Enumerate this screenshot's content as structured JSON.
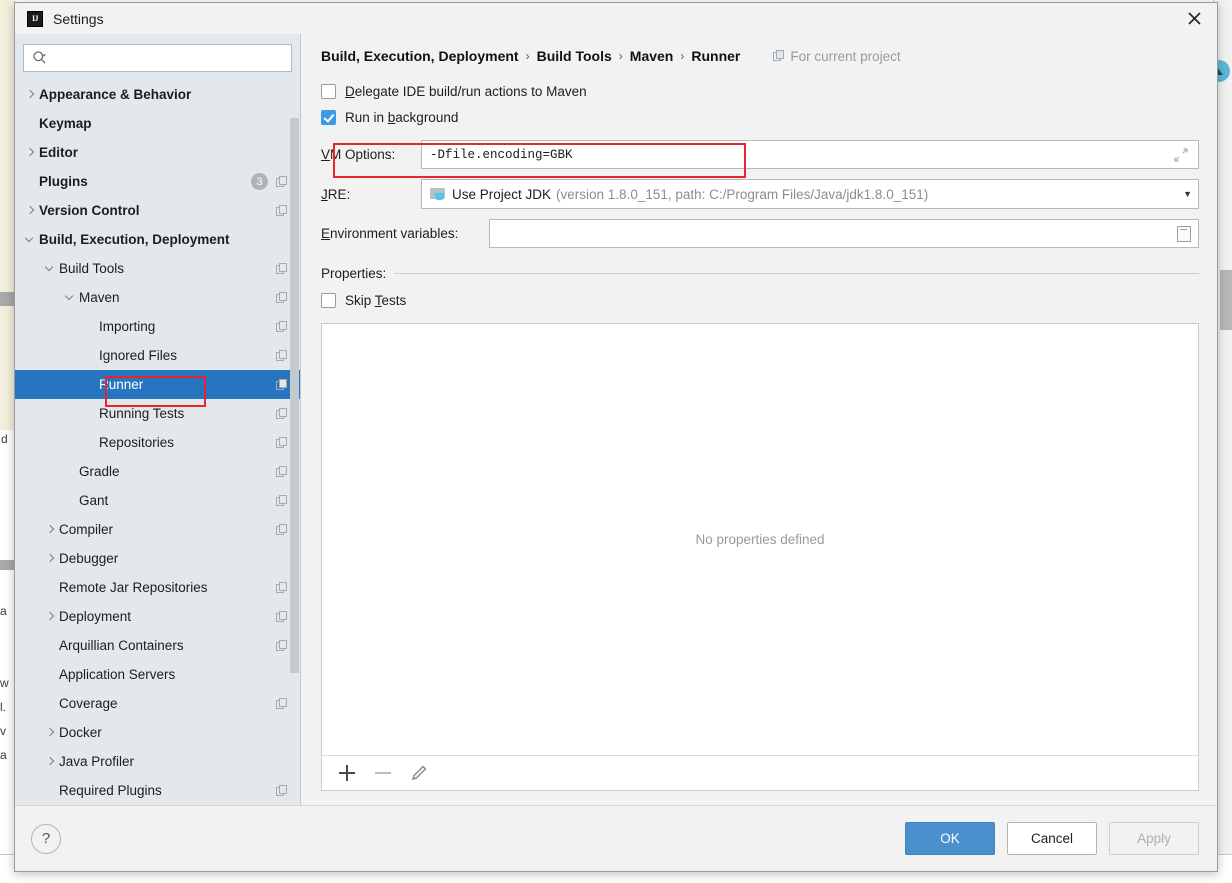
{
  "window": {
    "title": "Settings",
    "app_icon": "intellij-idea-icon",
    "close_icon": "close-icon"
  },
  "sidebar": {
    "search": {
      "placeholder": "",
      "value": "",
      "icon": "search-icon"
    },
    "items": [
      {
        "label": "Appearance & Behavior",
        "indent": 0,
        "arrow": "right",
        "bold": true,
        "project_icon": false,
        "badge": null,
        "selected": false
      },
      {
        "label": "Keymap",
        "indent": 0,
        "arrow": "none",
        "bold": true,
        "project_icon": false,
        "badge": null,
        "selected": false
      },
      {
        "label": "Editor",
        "indent": 0,
        "arrow": "right",
        "bold": true,
        "project_icon": false,
        "badge": null,
        "selected": false
      },
      {
        "label": "Plugins",
        "indent": 0,
        "arrow": "none",
        "bold": true,
        "project_icon": true,
        "badge": "3",
        "selected": false
      },
      {
        "label": "Version Control",
        "indent": 0,
        "arrow": "right",
        "bold": true,
        "project_icon": true,
        "badge": null,
        "selected": false
      },
      {
        "label": "Build, Execution, Deployment",
        "indent": 0,
        "arrow": "down",
        "bold": true,
        "project_icon": false,
        "badge": null,
        "selected": false
      },
      {
        "label": "Build Tools",
        "indent": 1,
        "arrow": "down",
        "bold": false,
        "project_icon": true,
        "badge": null,
        "selected": false
      },
      {
        "label": "Maven",
        "indent": 2,
        "arrow": "down",
        "bold": false,
        "project_icon": true,
        "badge": null,
        "selected": false
      },
      {
        "label": "Importing",
        "indent": 3,
        "arrow": "none",
        "bold": false,
        "project_icon": true,
        "badge": null,
        "selected": false
      },
      {
        "label": "Ignored Files",
        "indent": 3,
        "arrow": "none",
        "bold": false,
        "project_icon": true,
        "badge": null,
        "selected": false
      },
      {
        "label": "Runner",
        "indent": 3,
        "arrow": "none",
        "bold": false,
        "project_icon": true,
        "badge": null,
        "selected": true
      },
      {
        "label": "Running Tests",
        "indent": 3,
        "arrow": "none",
        "bold": false,
        "project_icon": true,
        "badge": null,
        "selected": false
      },
      {
        "label": "Repositories",
        "indent": 3,
        "arrow": "none",
        "bold": false,
        "project_icon": true,
        "badge": null,
        "selected": false
      },
      {
        "label": "Gradle",
        "indent": 2,
        "arrow": "none",
        "bold": false,
        "project_icon": true,
        "badge": null,
        "selected": false
      },
      {
        "label": "Gant",
        "indent": 2,
        "arrow": "none",
        "bold": false,
        "project_icon": true,
        "badge": null,
        "selected": false
      },
      {
        "label": "Compiler",
        "indent": 1,
        "arrow": "right",
        "bold": false,
        "project_icon": true,
        "badge": null,
        "selected": false
      },
      {
        "label": "Debugger",
        "indent": 1,
        "arrow": "right",
        "bold": false,
        "project_icon": false,
        "badge": null,
        "selected": false
      },
      {
        "label": "Remote Jar Repositories",
        "indent": 1,
        "arrow": "none",
        "bold": false,
        "project_icon": true,
        "badge": null,
        "selected": false
      },
      {
        "label": "Deployment",
        "indent": 1,
        "arrow": "right",
        "bold": false,
        "project_icon": true,
        "badge": null,
        "selected": false
      },
      {
        "label": "Arquillian Containers",
        "indent": 1,
        "arrow": "none",
        "bold": false,
        "project_icon": true,
        "badge": null,
        "selected": false
      },
      {
        "label": "Application Servers",
        "indent": 1,
        "arrow": "none",
        "bold": false,
        "project_icon": false,
        "badge": null,
        "selected": false
      },
      {
        "label": "Coverage",
        "indent": 1,
        "arrow": "none",
        "bold": false,
        "project_icon": true,
        "badge": null,
        "selected": false
      },
      {
        "label": "Docker",
        "indent": 1,
        "arrow": "right",
        "bold": false,
        "project_icon": false,
        "badge": null,
        "selected": false
      },
      {
        "label": "Java Profiler",
        "indent": 1,
        "arrow": "right",
        "bold": false,
        "project_icon": false,
        "badge": null,
        "selected": false
      },
      {
        "label": "Required Plugins",
        "indent": 1,
        "arrow": "none",
        "bold": false,
        "project_icon": true,
        "badge": null,
        "selected": false
      }
    ]
  },
  "main": {
    "breadcrumb": {
      "parts": [
        "Build, Execution, Deployment",
        "Build Tools",
        "Maven",
        "Runner"
      ],
      "separator": "›",
      "scope_label": "For current project",
      "scope_icon": "project-scope-icon"
    },
    "delegate": {
      "label_before": "D",
      "label_after": "elegate IDE build/run actions to Maven",
      "checked": false
    },
    "run_in_background": {
      "label_before": "Run in b",
      "label_mid": "b",
      "label_after": "ackground",
      "checked": true
    },
    "vm_options": {
      "label_u": "V",
      "label_rest": "M Options:",
      "value": "-Dfile.encoding=GBK",
      "expand_icon": "expand-icon"
    },
    "jre": {
      "label_u": "J",
      "label_rest": "RE:",
      "value_main": "Use Project JDK",
      "value_sub": "(version 1.8.0_151, path: C:/Program Files/Java/jdk1.8.0_151)",
      "icon": "jdk-folder-icon",
      "arrow_icon": "chevron-down-icon"
    },
    "env_vars": {
      "label_u": "E",
      "label_rest": "nvironment variables:",
      "value": "",
      "browse_icon": "list-editor-icon"
    },
    "properties": {
      "section_label": "Properties:",
      "skip_tests": {
        "label_before": "Skip ",
        "label_u": "T",
        "label_after": "ests",
        "checked": false
      },
      "empty_text": "No properties defined",
      "toolbar": [
        {
          "name": "add",
          "icon": "plus-icon",
          "enabled": true
        },
        {
          "name": "remove",
          "icon": "minus-icon",
          "enabled": false
        },
        {
          "name": "edit",
          "icon": "pencil-icon",
          "enabled": true
        }
      ]
    }
  },
  "footer": {
    "help_label": "?",
    "ok_label": "OK",
    "cancel_label": "Cancel",
    "apply_label": "Apply"
  },
  "annotations": [
    {
      "name": "runner-highlight",
      "color": "#e8252a"
    },
    {
      "name": "vm-options-highlight",
      "color": "#e8252a"
    }
  ],
  "colors": {
    "selection_blue": "#2675bf",
    "primary_button": "#4a90cf",
    "annotation_red": "#e8252a",
    "sidebar_bg": "#e3e8ec",
    "dialog_bg": "#f2f2f2"
  }
}
